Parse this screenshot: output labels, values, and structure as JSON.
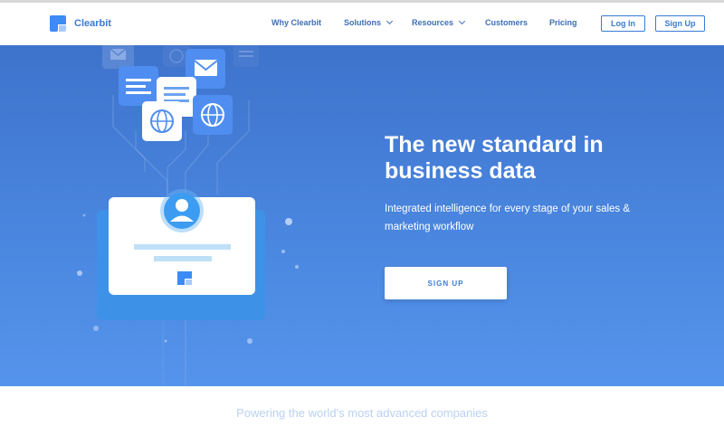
{
  "brand": {
    "name": "Clearbit"
  },
  "nav": {
    "items": [
      {
        "label": "Why Clearbit"
      },
      {
        "label": "Solutions",
        "dropdown": true
      },
      {
        "label": "Resources",
        "dropdown": true
      },
      {
        "label": "Customers"
      },
      {
        "label": "Pricing"
      }
    ],
    "login_label": "Log In",
    "signup_label": "Sign Up"
  },
  "hero": {
    "headline_line1": "The new standard in",
    "headline_line2": "business data",
    "subtext_line1": "Integrated intelligence for every stage of your sales &",
    "subtext_line2": "marketing workflow",
    "cta_label": "SIGN UP"
  },
  "footer": {
    "tagline": "Powering the world's most advanced companies"
  },
  "icons": [
    "logo-mark",
    "chevron-down-icon",
    "mail-icon",
    "document-icon",
    "globe-icon",
    "user-avatar-icon"
  ],
  "colors": {
    "brand_blue": "#3a7bd5",
    "hero_top": "#3e73cc",
    "hero_bottom": "#5594ec",
    "white": "#ffffff"
  }
}
